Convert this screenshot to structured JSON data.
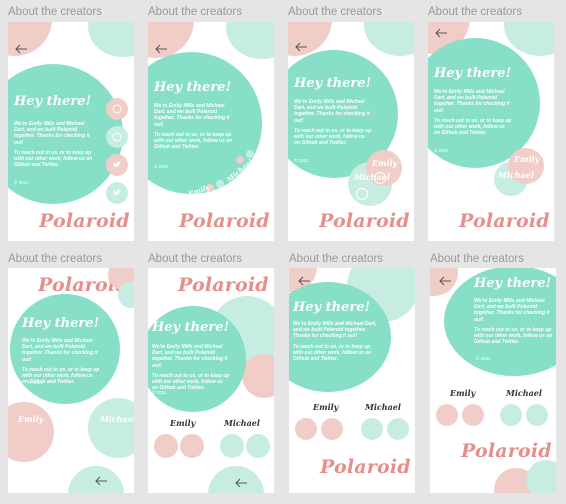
{
  "caption": "About the creators",
  "logo": "Polaroid",
  "heading": "Hey there!",
  "intro": "We're Emily Mills and Michael Dart, and we built Polaroid together. Thanks for checking it out!",
  "reach": "To reach out to us, or to keep up with our other work, follow us on Github and Twitter.",
  "copyright": "© 2021",
  "names": {
    "emily": "Emily",
    "michael": "Michael"
  },
  "icons": [
    "back-arrow-icon",
    "github-icon",
    "twitter-icon"
  ],
  "colors": {
    "teal": "#86dfc6",
    "mint": "#c7ede3",
    "pink": "#f1cdc8",
    "logo": "#e68f8a"
  }
}
